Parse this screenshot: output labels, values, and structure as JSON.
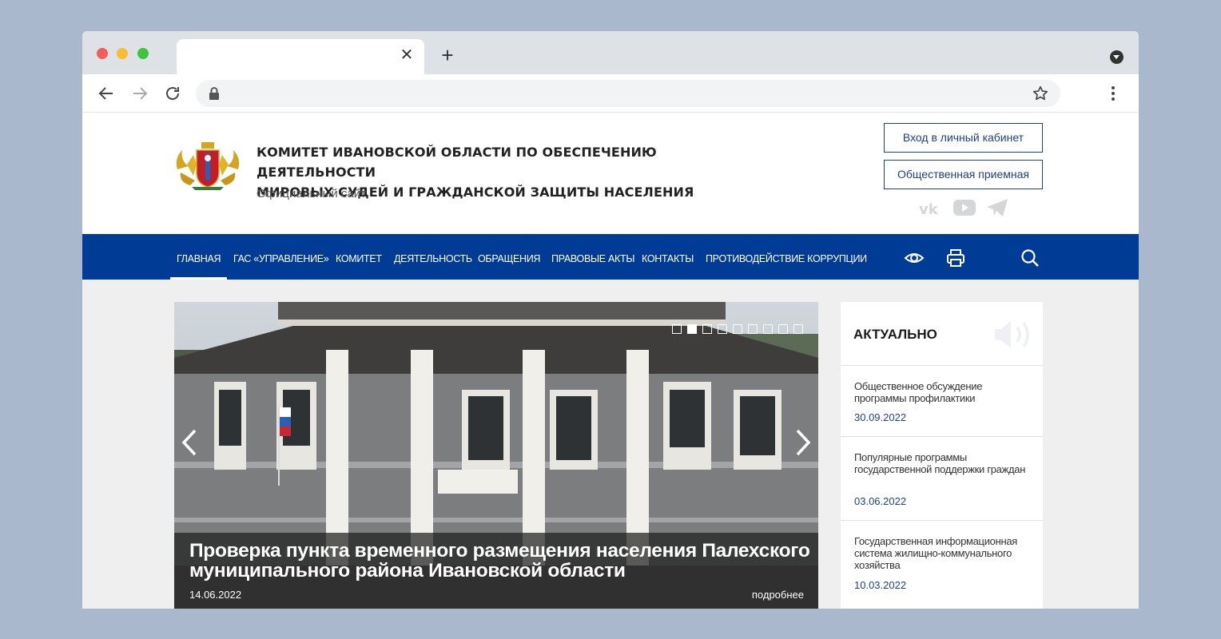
{
  "browser": {
    "tab_close_glyph": "✕",
    "new_tab_glyph": "+"
  },
  "header": {
    "title_line1": "КОМИТЕТ ИВАНОВСКОЙ ОБЛАСТИ ПО ОБЕСПЕЧЕНИЮ ДЕЯТЕЛЬНОСТИ",
    "title_line2": "МИРОВЫХ СУДЕЙ И ГРАЖДАНСКОЙ ЗАЩИТЫ НАСЕЛЕНИЯ",
    "subtitle": "Официальный сайт",
    "login_button": "Вход в личный кабинет",
    "reception_button": "Общественная приемная",
    "social": [
      "vk-icon",
      "youtube-icon",
      "telegram-icon"
    ]
  },
  "nav": {
    "items": [
      {
        "label": "ГЛАВНАЯ",
        "active": true
      },
      {
        "label": "ГАС «УПРАВЛЕНИЕ»"
      },
      {
        "label": "КОМИТЕТ"
      },
      {
        "label": "ДЕЯТЕЛЬНОСТЬ"
      },
      {
        "label": "ОБРАЩЕНИЯ"
      },
      {
        "label": "ПРАВОВЫЕ АКТЫ"
      },
      {
        "label": "КОНТАКТЫ"
      },
      {
        "label": "ПРОТИВОДЕЙСТВИЕ КОРРУПЦИИ"
      }
    ],
    "icons": [
      "eye-icon",
      "print-icon",
      "search-icon"
    ]
  },
  "slider": {
    "title": "Проверка пункта временного размещения населения Палехского муниципального района Ивановской области",
    "date": "14.06.2022",
    "more": "подробнее",
    "slide_count": 9,
    "current_slide": 2
  },
  "aside": {
    "title": "АКТУАЛЬНО",
    "items": [
      {
        "text": "Общественное обсуждение программы профилактики",
        "date": "30.09.2022"
      },
      {
        "text": "Популярные программы государственной поддержки граждан",
        "date": "03.06.2022"
      },
      {
        "text": "Государственная информационная система жилищно-коммунального хозяйства",
        "date": "10.03.2022"
      }
    ]
  },
  "colors": {
    "nav_bg": "#003c96",
    "accent": "#1d3f8c",
    "page_bg": "#efefef",
    "outer_bg": "#aab8cd"
  }
}
